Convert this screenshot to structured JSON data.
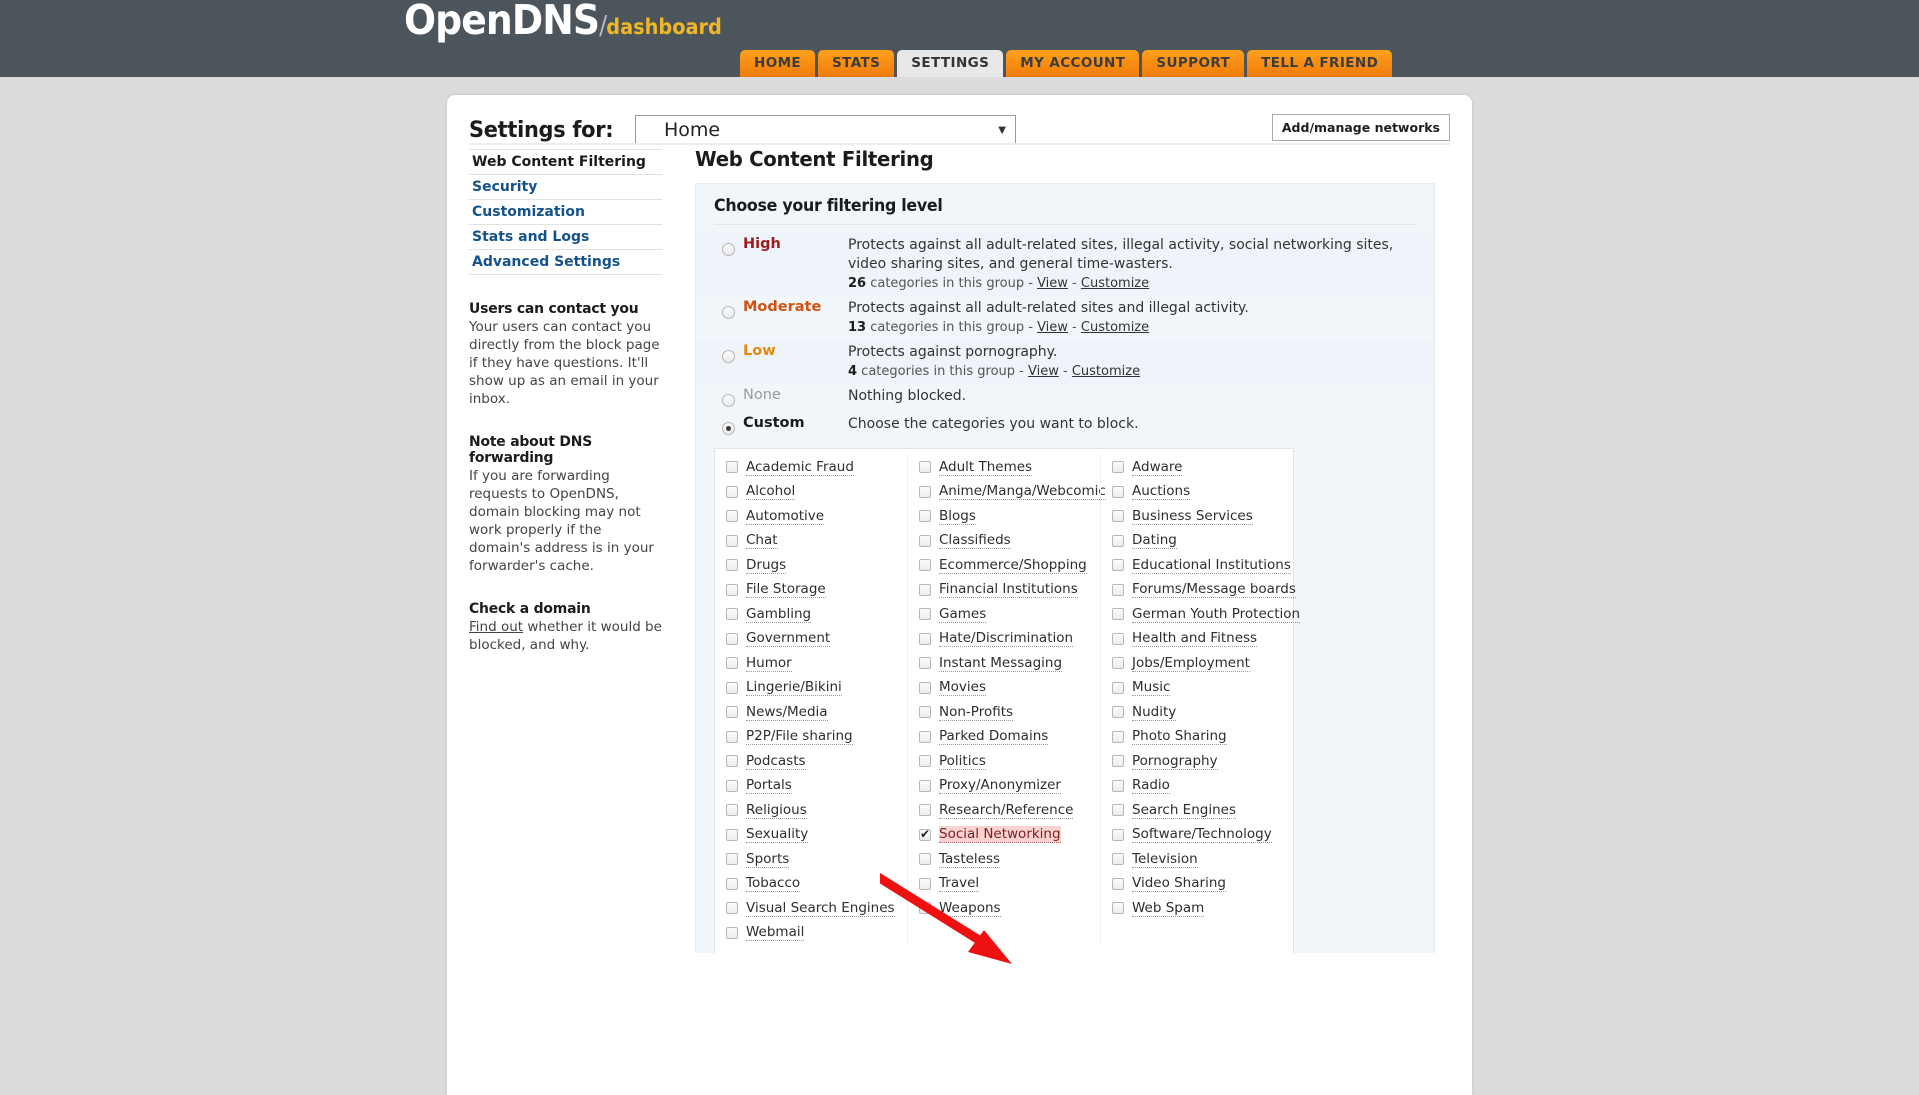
{
  "brand": {
    "name": "OpenDNS",
    "slash": "/",
    "sub": "dashboard"
  },
  "nav": {
    "tabs": [
      {
        "label": "HOME",
        "active": false
      },
      {
        "label": "STATS",
        "active": false
      },
      {
        "label": "SETTINGS",
        "active": true
      },
      {
        "label": "MY ACCOUNT",
        "active": false
      },
      {
        "label": "SUPPORT",
        "active": false
      },
      {
        "label": "TELL A FRIEND",
        "active": false
      }
    ]
  },
  "header": {
    "settings_for_label": "Settings for:",
    "network_value": "Home",
    "caret_icon": "▼",
    "add_manage_label": "Add/manage networks"
  },
  "sidebar": {
    "items": [
      {
        "label": "Web Content Filtering"
      },
      {
        "label": "Security"
      },
      {
        "label": "Customization"
      },
      {
        "label": "Stats and Logs"
      },
      {
        "label": "Advanced Settings"
      }
    ],
    "blocks": [
      {
        "title": "Users can contact you",
        "text": "Your users can contact you directly from the block page if they have questions. It'll show up as an email in your inbox."
      },
      {
        "title": "Note about DNS forwarding",
        "text": "If you are forwarding requests to OpenDNS, domain blocking may not work properly if the domain's address is in your forwarder's cache."
      }
    ],
    "check_domain": {
      "title": "Check a domain",
      "link": "Find out",
      "text": " whether it would be blocked, and why."
    }
  },
  "main": {
    "title": "Web Content Filtering",
    "panel_title": "Choose your filtering level",
    "levels": [
      {
        "name": "High",
        "color": "#9e1b1b",
        "selected": false,
        "description": "Protects against all adult-related sites, illegal activity, social networking sites, video sharing sites, and general time-wasters.",
        "count": "26",
        "count_suffix": " categories in this group - ",
        "view": "View",
        "sep": " - ",
        "customize": "Customize"
      },
      {
        "name": "Moderate",
        "color": "#d1530f",
        "selected": false,
        "description": "Protects against all adult-related sites and illegal activity.",
        "count": "13",
        "count_suffix": " categories in this group - ",
        "view": "View",
        "sep": " - ",
        "customize": "Customize"
      },
      {
        "name": "Low",
        "color": "#e8890a",
        "selected": false,
        "description": "Protects against pornography.",
        "count": "4",
        "count_suffix": " categories in this group - ",
        "view": "View",
        "sep": " - ",
        "customize": "Customize"
      },
      {
        "name": "None",
        "color": "#9a9a9a",
        "selected": false,
        "description": "Nothing blocked.",
        "count": "",
        "count_suffix": "",
        "view": "",
        "sep": "",
        "customize": ""
      },
      {
        "name": "Custom",
        "color": "#1b1b1b",
        "selected": true,
        "description": "Choose the categories you want to block.",
        "count": "",
        "count_suffix": "",
        "view": "",
        "sep": "",
        "customize": ""
      }
    ],
    "categories": {
      "columns": [
        [
          {
            "label": "Academic Fraud",
            "checked": false
          },
          {
            "label": "Alcohol",
            "checked": false
          },
          {
            "label": "Automotive",
            "checked": false
          },
          {
            "label": "Chat",
            "checked": false
          },
          {
            "label": "Drugs",
            "checked": false
          },
          {
            "label": "File Storage",
            "checked": false
          },
          {
            "label": "Gambling",
            "checked": false
          },
          {
            "label": "Government",
            "checked": false
          },
          {
            "label": "Humor",
            "checked": false
          },
          {
            "label": "Lingerie/Bikini",
            "checked": false
          },
          {
            "label": "News/Media",
            "checked": false
          },
          {
            "label": "P2P/File sharing",
            "checked": false
          },
          {
            "label": "Podcasts",
            "checked": false
          },
          {
            "label": "Portals",
            "checked": false
          },
          {
            "label": "Religious",
            "checked": false
          },
          {
            "label": "Sexuality",
            "checked": false
          },
          {
            "label": "Sports",
            "checked": false
          },
          {
            "label": "Tobacco",
            "checked": false
          },
          {
            "label": "Visual Search Engines",
            "checked": false
          },
          {
            "label": "Webmail",
            "checked": false
          }
        ],
        [
          {
            "label": "Adult Themes",
            "checked": false
          },
          {
            "label": "Anime/Manga/Webcomic",
            "checked": false
          },
          {
            "label": "Blogs",
            "checked": false
          },
          {
            "label": "Classifieds",
            "checked": false
          },
          {
            "label": "Ecommerce/Shopping",
            "checked": false
          },
          {
            "label": "Financial Institutions",
            "checked": false
          },
          {
            "label": "Games",
            "checked": false
          },
          {
            "label": "Hate/Discrimination",
            "checked": false
          },
          {
            "label": "Instant Messaging",
            "checked": false
          },
          {
            "label": "Movies",
            "checked": false
          },
          {
            "label": "Non-Profits",
            "checked": false
          },
          {
            "label": "Parked Domains",
            "checked": false
          },
          {
            "label": "Politics",
            "checked": false
          },
          {
            "label": "Proxy/Anonymizer",
            "checked": false
          },
          {
            "label": "Research/Reference",
            "checked": false
          },
          {
            "label": "Social Networking",
            "checked": true
          },
          {
            "label": "Tasteless",
            "checked": false
          },
          {
            "label": "Travel",
            "checked": false
          },
          {
            "label": "Weapons",
            "checked": false
          }
        ],
        [
          {
            "label": "Adware",
            "checked": false
          },
          {
            "label": "Auctions",
            "checked": false
          },
          {
            "label": "Business Services",
            "checked": false
          },
          {
            "label": "Dating",
            "checked": false
          },
          {
            "label": "Educational Institutions",
            "checked": false
          },
          {
            "label": "Forums/Message boards",
            "checked": false
          },
          {
            "label": "German Youth Protection",
            "checked": false
          },
          {
            "label": "Health and Fitness",
            "checked": false
          },
          {
            "label": "Jobs/Employment",
            "checked": false
          },
          {
            "label": "Music",
            "checked": false
          },
          {
            "label": "Nudity",
            "checked": false
          },
          {
            "label": "Photo Sharing",
            "checked": false
          },
          {
            "label": "Pornography",
            "checked": false
          },
          {
            "label": "Radio",
            "checked": false
          },
          {
            "label": "Search Engines",
            "checked": false
          },
          {
            "label": "Software/Technology",
            "checked": false
          },
          {
            "label": "Television",
            "checked": false
          },
          {
            "label": "Video Sharing",
            "checked": false
          },
          {
            "label": "Web Spam",
            "checked": false
          }
        ]
      ]
    }
  },
  "annotation": {
    "arrow_color": "#ee1111",
    "points_to": "Social Networking"
  },
  "colors": {
    "topbar": "#4c545c",
    "page": "#dcdcdc",
    "tab_orange": "#f4880f",
    "link_blue": "#14528c",
    "panel_blue": "#f1f6fb",
    "highlight_pink": "#fbd2d2"
  }
}
